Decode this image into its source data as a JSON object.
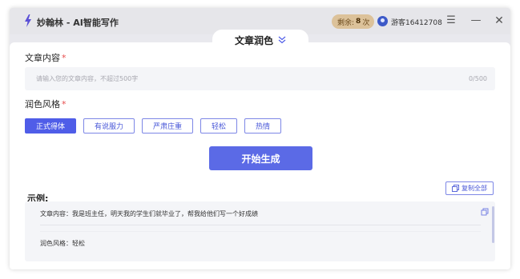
{
  "app": {
    "title": "妙翰林 - AI智能写作"
  },
  "header": {
    "quota_label": "剩余:",
    "quota_value": "8",
    "quota_unit": "次",
    "username": "游客16412708"
  },
  "tab": {
    "label": "文章润色"
  },
  "content": {
    "label": "文章内容",
    "required_mark": "*",
    "placeholder": "请输入您的文章内容，不超过500字",
    "counter": "0/500"
  },
  "style": {
    "label": "润色风格",
    "required_mark": "*",
    "options": [
      "正式得体",
      "有说服力",
      "严肃庄重",
      "轻松",
      "热情"
    ],
    "selected": "正式得体"
  },
  "generate_label": "开始生成",
  "example": {
    "label": "示例:",
    "copy_all_label": "复制全部",
    "line1": "文章内容：我是班主任，明天我的学生们就毕业了，帮我给他们写一个好成绩",
    "line2": "润色风格：轻松"
  },
  "colors": {
    "accent": "#4f5de8",
    "quota_badge": "#dcc29a",
    "required": "#e64b4b"
  }
}
